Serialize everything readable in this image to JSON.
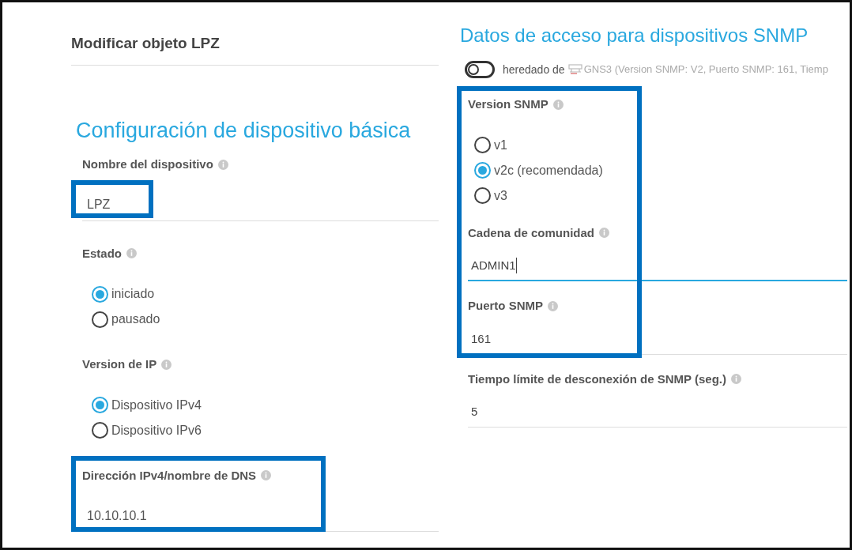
{
  "page_title": "Modificar objeto LPZ",
  "left": {
    "heading": "Configuración de dispositivo básica",
    "fields": [
      {
        "kind": "text",
        "label": "Nombre del dispositivo",
        "value": "LPZ",
        "value_highlighted": true,
        "field_highlighted": false
      },
      {
        "kind": "radio",
        "label": "Estado",
        "options": [
          {
            "label": "iniciado",
            "selected": true
          },
          {
            "label": "pausado",
            "selected": false
          }
        ]
      },
      {
        "kind": "radio",
        "label": "Version de IP",
        "options": [
          {
            "label": "Dispositivo IPv4",
            "selected": true
          },
          {
            "label": "Dispositivo IPv6",
            "selected": false
          }
        ]
      },
      {
        "kind": "text",
        "label": "Dirección IPv4/nombre de DNS",
        "value": "10.10.10.1",
        "value_highlighted": false,
        "field_highlighted": true
      }
    ]
  },
  "right": {
    "heading": "Datos de acceso para dispositivos SNMP",
    "inherit": {
      "on": false,
      "label": "heredado de",
      "source": "GNS3 (Version SNMP: V2, Puerto SNMP: 161, Tiemp"
    },
    "groups": [
      {
        "highlighted": true,
        "fields": [
          {
            "kind": "radio",
            "label": "Version SNMP",
            "options": [
              {
                "label": "v1",
                "selected": false
              },
              {
                "label": "v2c (recomendada)",
                "selected": true
              },
              {
                "label": "v3",
                "selected": false
              }
            ]
          },
          {
            "kind": "text",
            "label": "Cadena de comunidad",
            "value": "ADMIN1",
            "focused": true
          },
          {
            "kind": "text",
            "label": "Puerto SNMP",
            "value": "161",
            "focused": false
          }
        ]
      },
      {
        "highlighted": false,
        "fields": [
          {
            "kind": "text",
            "label": "Tiempo límite de desconexión de SNMP (seg.)",
            "value": "5",
            "focused": false
          }
        ]
      }
    ]
  }
}
